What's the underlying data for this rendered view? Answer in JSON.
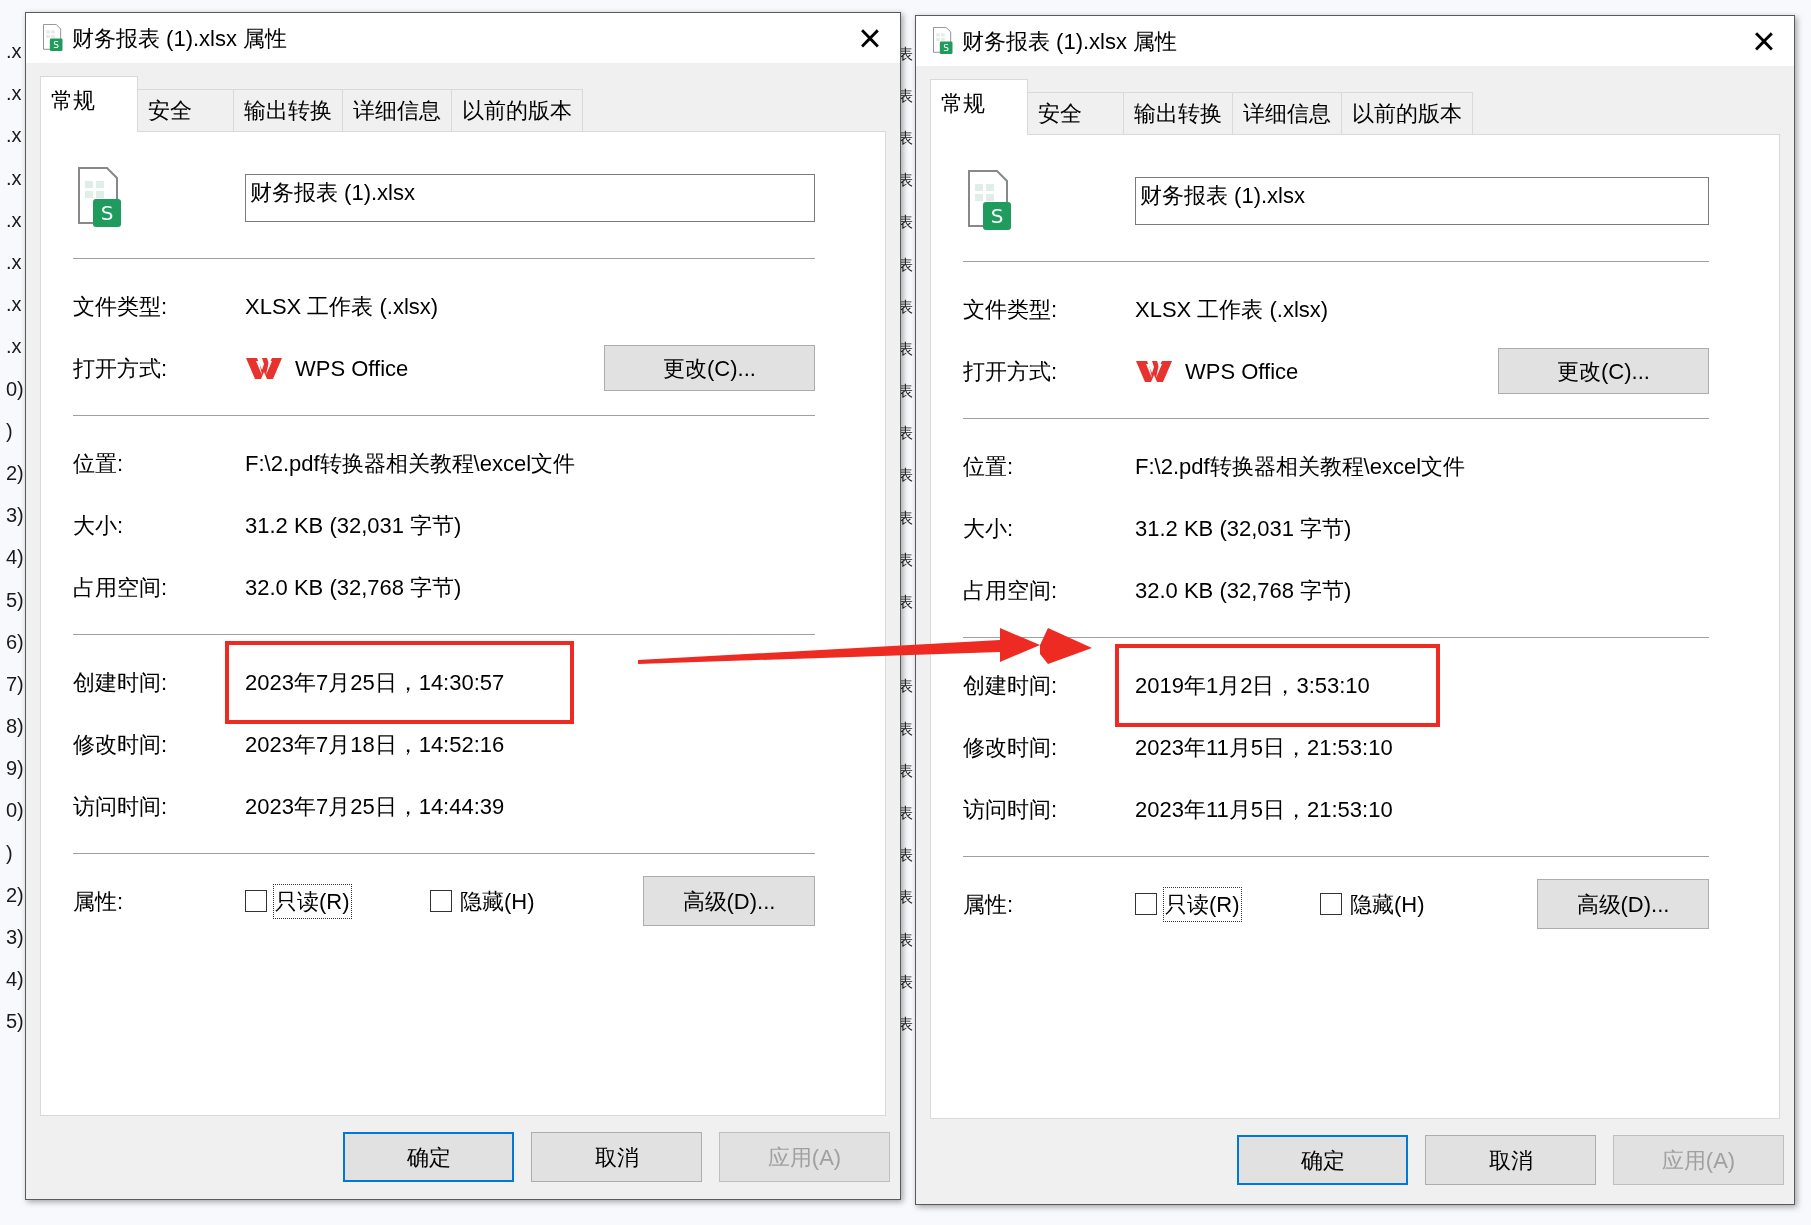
{
  "background": {
    "left_column": [
      ".x",
      ".x",
      ".x",
      ".x",
      ".x",
      ".x",
      ".x",
      ".x",
      "0)",
      ")",
      "2)",
      "3)",
      "4)",
      "5)",
      "6)",
      "7)",
      "8)",
      "9)",
      "0)",
      ")",
      "2)",
      "3)",
      "4)",
      "5)"
    ],
    "middle_column_upper": [
      "表",
      "表",
      "表",
      "表",
      "表",
      "表",
      "表",
      "表",
      "表",
      "表",
      "表",
      "表",
      "表",
      "表"
    ],
    "middle_column_lower": [
      "表",
      "表",
      "表",
      "表",
      "表",
      "表",
      "表",
      "表",
      "表"
    ]
  },
  "dialogs": [
    {
      "title": "财务报表 (1).xlsx 属性",
      "title_icon_letter": "S",
      "close": "×",
      "tabs": [
        {
          "label": "常规",
          "selected": true
        },
        {
          "label": "安全",
          "selected": false
        },
        {
          "label": "输出转换",
          "selected": false
        },
        {
          "label": "详细信息",
          "selected": false
        },
        {
          "label": "以前的版本",
          "selected": false
        }
      ],
      "file_icon_letter": "S",
      "file_name": "财务报表 (1).xlsx",
      "sections": [
        [
          {
            "kind": "text",
            "label": "文件类型:",
            "value": "XLSX 工作表 (.xlsx)",
            "highlighted": false
          },
          {
            "kind": "app",
            "label": "打开方式:",
            "value": "WPS Office",
            "button": "更改(C)...",
            "highlighted": false
          }
        ],
        [
          {
            "kind": "text",
            "label": "位置:",
            "value": "F:\\2.pdf转换器相关教程\\excel文件",
            "highlighted": false
          },
          {
            "kind": "text",
            "label": "大小:",
            "value": "31.2 KB (32,031 字节)",
            "highlighted": false
          },
          {
            "kind": "text",
            "label": "占用空间:",
            "value": "32.0 KB (32,768 字节)",
            "highlighted": false
          }
        ],
        [
          {
            "kind": "text",
            "label": "创建时间:",
            "value": "2023年7月25日，14:30:57",
            "highlighted": true
          },
          {
            "kind": "text",
            "label": "修改时间:",
            "value": "2023年7月18日，14:52:16",
            "highlighted": false
          },
          {
            "kind": "text",
            "label": "访问时间:",
            "value": "2023年7月25日，14:44:39",
            "highlighted": false
          }
        ]
      ],
      "attributes_label": "属性:",
      "checkboxes": [
        {
          "label": "只读(R)",
          "checked": false,
          "focused": true
        },
        {
          "label": "隐藏(H)",
          "checked": false,
          "focused": false
        }
      ],
      "advanced_button": "高级(D)...",
      "buttons": [
        {
          "label": "确定",
          "default": true,
          "disabled": false
        },
        {
          "label": "取消",
          "default": false,
          "disabled": false
        },
        {
          "label": "应用(A)",
          "default": false,
          "disabled": true
        }
      ]
    },
    {
      "title": "财务报表 (1).xlsx 属性",
      "title_icon_letter": "S",
      "close": "×",
      "tabs": [
        {
          "label": "常规",
          "selected": true
        },
        {
          "label": "安全",
          "selected": false
        },
        {
          "label": "输出转换",
          "selected": false
        },
        {
          "label": "详细信息",
          "selected": false
        },
        {
          "label": "以前的版本",
          "selected": false
        }
      ],
      "file_icon_letter": "S",
      "file_name": "财务报表 (1).xlsx",
      "sections": [
        [
          {
            "kind": "text",
            "label": "文件类型:",
            "value": "XLSX 工作表 (.xlsx)",
            "highlighted": false
          },
          {
            "kind": "app",
            "label": "打开方式:",
            "value": "WPS Office",
            "button": "更改(C)...",
            "highlighted": false
          }
        ],
        [
          {
            "kind": "text",
            "label": "位置:",
            "value": "F:\\2.pdf转换器相关教程\\excel文件",
            "highlighted": false
          },
          {
            "kind": "text",
            "label": "大小:",
            "value": "31.2 KB (32,031 字节)",
            "highlighted": false
          },
          {
            "kind": "text",
            "label": "占用空间:",
            "value": "32.0 KB (32,768 字节)",
            "highlighted": false
          }
        ],
        [
          {
            "kind": "text",
            "label": "创建时间:",
            "value": "2019年1月2日，3:53:10",
            "highlighted": true
          },
          {
            "kind": "text",
            "label": "修改时间:",
            "value": "2023年11月5日，21:53:10",
            "highlighted": false
          },
          {
            "kind": "text",
            "label": "访问时间:",
            "value": "2023年11月5日，21:53:10",
            "highlighted": false
          }
        ]
      ],
      "attributes_label": "属性:",
      "checkboxes": [
        {
          "label": "只读(R)",
          "checked": false,
          "focused": true
        },
        {
          "label": "隐藏(H)",
          "checked": false,
          "focused": false
        }
      ],
      "advanced_button": "高级(D)...",
      "buttons": [
        {
          "label": "确定",
          "default": true,
          "disabled": false
        },
        {
          "label": "取消",
          "default": false,
          "disabled": false
        },
        {
          "label": "应用(A)",
          "default": false,
          "disabled": true
        }
      ]
    }
  ]
}
